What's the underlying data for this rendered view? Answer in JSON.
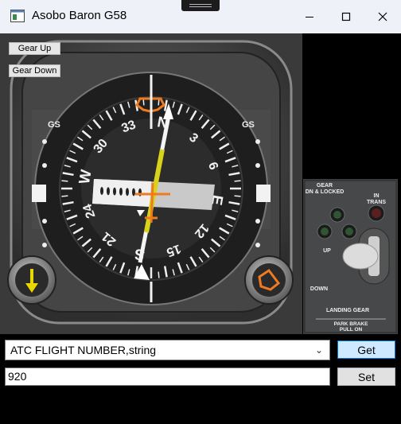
{
  "window": {
    "title": "Asobo Baron G58"
  },
  "panel_buttons": {
    "gear_up": "Gear Up",
    "gear_down": "Gear Down"
  },
  "hsi": {
    "gs_left": "GS",
    "gs_right": "GS",
    "compass_labels": [
      "N",
      "3",
      "6",
      "E",
      "12",
      "15",
      "S",
      "21",
      "24",
      "W",
      "30",
      "33"
    ]
  },
  "gear_panel": {
    "dn_locked": [
      "GEAR",
      "DN & LOCKED"
    ],
    "in_trans": [
      "IN",
      "TRANS"
    ],
    "up": "UP",
    "down": "DOWN",
    "landing_gear": "LANDING  GEAR",
    "park_brake": [
      "PARK BRAKE",
      "PULL ON"
    ]
  },
  "controls": {
    "variable_select": "ATC FLIGHT NUMBER,string",
    "value_input": "920",
    "get_label": "Get",
    "set_label": "Set"
  },
  "colors": {
    "accent_orange": "#f07a1e",
    "needle_yellow": "#d9d21a",
    "get_blue": "#cde8ff"
  }
}
